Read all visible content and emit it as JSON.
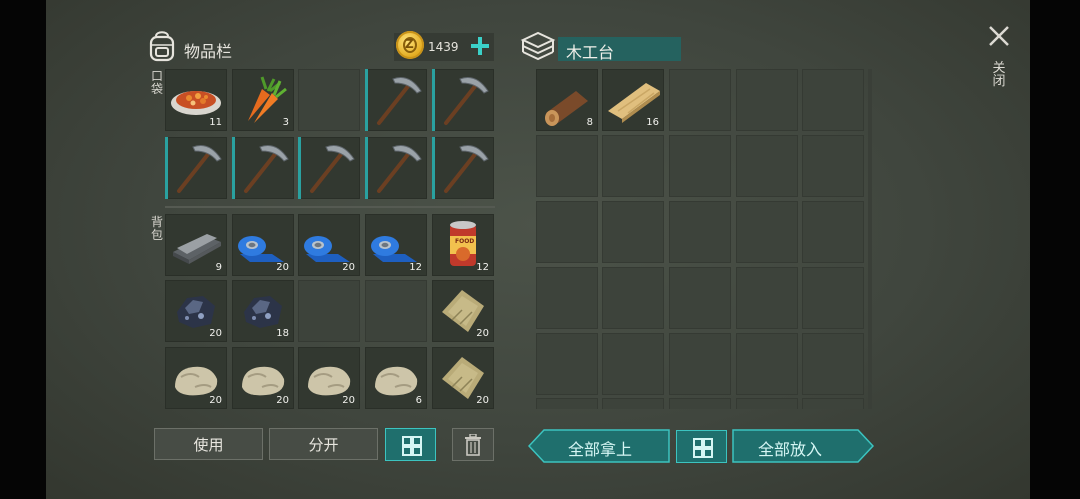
{
  "inventory": {
    "title": "物品栏",
    "coin_amount": "1439",
    "pocket_label": "口袋",
    "backpack_label": "背包",
    "pocket_row1": [
      {
        "icon": "stew-bowl-icon",
        "count": "11"
      },
      {
        "icon": "carrot-icon",
        "count": "3"
      },
      {
        "icon": "",
        "count": ""
      },
      {
        "icon": "pickaxe-icon",
        "count": ""
      },
      {
        "icon": "pickaxe-icon",
        "count": ""
      }
    ],
    "pocket_row2": [
      {
        "icon": "pickaxe-icon",
        "count": ""
      },
      {
        "icon": "pickaxe-icon",
        "count": ""
      },
      {
        "icon": "pickaxe-icon",
        "count": ""
      },
      {
        "icon": "pickaxe-icon",
        "count": ""
      },
      {
        "icon": "pickaxe-icon",
        "count": ""
      }
    ],
    "backpack_row1": [
      {
        "icon": "iron-ingot-icon",
        "count": "9"
      },
      {
        "icon": "duct-tape-icon",
        "count": "20"
      },
      {
        "icon": "duct-tape-icon",
        "count": "20"
      },
      {
        "icon": "duct-tape-icon",
        "count": "12"
      },
      {
        "icon": "canned-food-icon",
        "count": "12",
        "can_text": "FOOD"
      }
    ],
    "backpack_row2": [
      {
        "icon": "iron-ore-icon",
        "count": "20"
      },
      {
        "icon": "iron-ore-icon",
        "count": "18"
      },
      {
        "icon": "",
        "count": ""
      },
      {
        "icon": "",
        "count": ""
      },
      {
        "icon": "cloth-icon",
        "count": "20"
      }
    ],
    "backpack_row3": [
      {
        "icon": "stone-icon",
        "count": "20"
      },
      {
        "icon": "stone-icon",
        "count": "20"
      },
      {
        "icon": "stone-icon",
        "count": "20"
      },
      {
        "icon": "stone-icon",
        "count": "6"
      },
      {
        "icon": "cloth-icon",
        "count": "20"
      }
    ],
    "buttons": {
      "use": "使用",
      "split": "分开"
    }
  },
  "workbench": {
    "title": "木工台",
    "items": [
      {
        "icon": "log-icon",
        "count": "8"
      },
      {
        "icon": "plank-icon",
        "count": "16"
      }
    ],
    "buttons": {
      "take_all": "全部拿上",
      "put_all": "全部放入"
    }
  },
  "close_label": "关闭",
  "colors": {
    "accent": "#2aa1a0",
    "background": "#40463e",
    "slot": "#323830"
  }
}
